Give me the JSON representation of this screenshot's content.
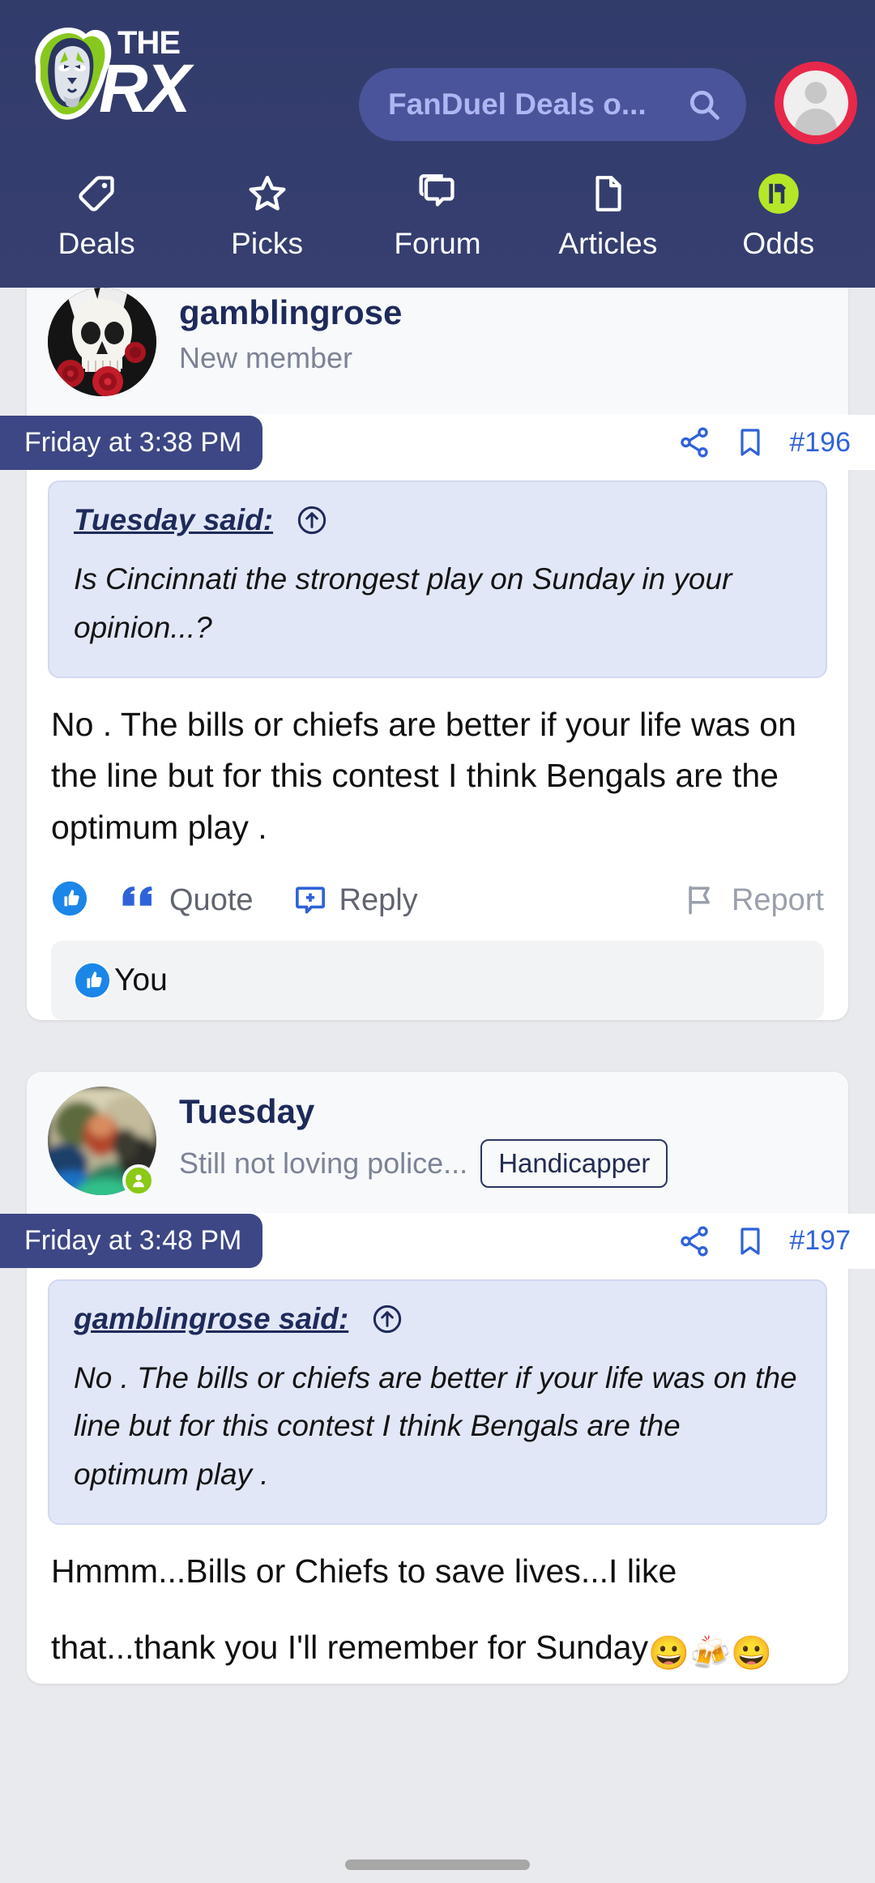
{
  "header": {
    "logo_alt": "THE RX",
    "logo_line1": "THE",
    "logo_line2": "RX",
    "search": {
      "value": "FanDuel Deals o...",
      "placeholder": "Search",
      "icon": "search-icon"
    },
    "account_icon": "user-avatar-icon"
  },
  "nav": {
    "items": [
      {
        "label": "Deals",
        "icon": "tag-icon"
      },
      {
        "label": "Picks",
        "icon": "star-icon"
      },
      {
        "label": "Forum",
        "icon": "chat-bubbles-icon"
      },
      {
        "label": "Articles",
        "icon": "document-icon"
      },
      {
        "label": "Odds",
        "icon": "odds-badge-icon"
      }
    ]
  },
  "posts": [
    {
      "author": "gamblingrose",
      "user_title": "New member",
      "badge": "",
      "avatar": "skull-roses-avatar",
      "online": false,
      "timestamp": "Friday at 3:38 PM",
      "post_number": "#196",
      "share_icon": "share-icon",
      "bookmark_icon": "bookmark-icon",
      "quote": {
        "author": "Tuesday said:",
        "jump_icon": "jump-to-post-icon",
        "text": "Is Cincinnati the strongest play on Sunday in your opinion...?"
      },
      "body": "No . The bills or chiefs are better if your life was on the line but for this contest I think Bengals are the optimum play .",
      "actions": {
        "like_icon": "thumbs-up-icon",
        "quote_icon": "quote-marks-icon",
        "quote_label": "Quote",
        "reply_icon": "reply-plus-icon",
        "reply_label": "Reply",
        "report_icon": "flag-icon",
        "report_label": "Report"
      },
      "reactions": {
        "icon": "thumbs-up-reaction-icon",
        "text": "You"
      }
    },
    {
      "author": "Tuesday",
      "user_title": "Still not loving police...",
      "badge": "Handicapper",
      "avatar": "photo-avatar",
      "online": true,
      "timestamp": "Friday at 3:48 PM",
      "post_number": "#197",
      "share_icon": "share-icon",
      "bookmark_icon": "bookmark-icon",
      "quote": {
        "author": "gamblingrose said:",
        "jump_icon": "jump-to-post-icon",
        "text": "No . The bills or chiefs are better if your life was on the line but for this contest I think Bengals are the optimum play ."
      },
      "body_line1": "Hmmm...Bills or Chiefs to save lives...I like",
      "body_line2": "that...thank you I'll remember for Sunday",
      "body_emoji": "😀🍻😀"
    }
  ],
  "colors": {
    "header_bg": "#343e6e",
    "search_bg": "#4a549a",
    "search_text": "#aeb6f3",
    "accent_green": "#b5e728",
    "avatar_ring": "#e8284a",
    "timestamp_chip": "#3d4785",
    "quote_bg": "#e2e7f8",
    "link_blue": "#2f62d8",
    "username_navy": "#1e2a5a",
    "page_bg": "#e9eaee"
  },
  "system": {
    "home_indicator": true
  }
}
